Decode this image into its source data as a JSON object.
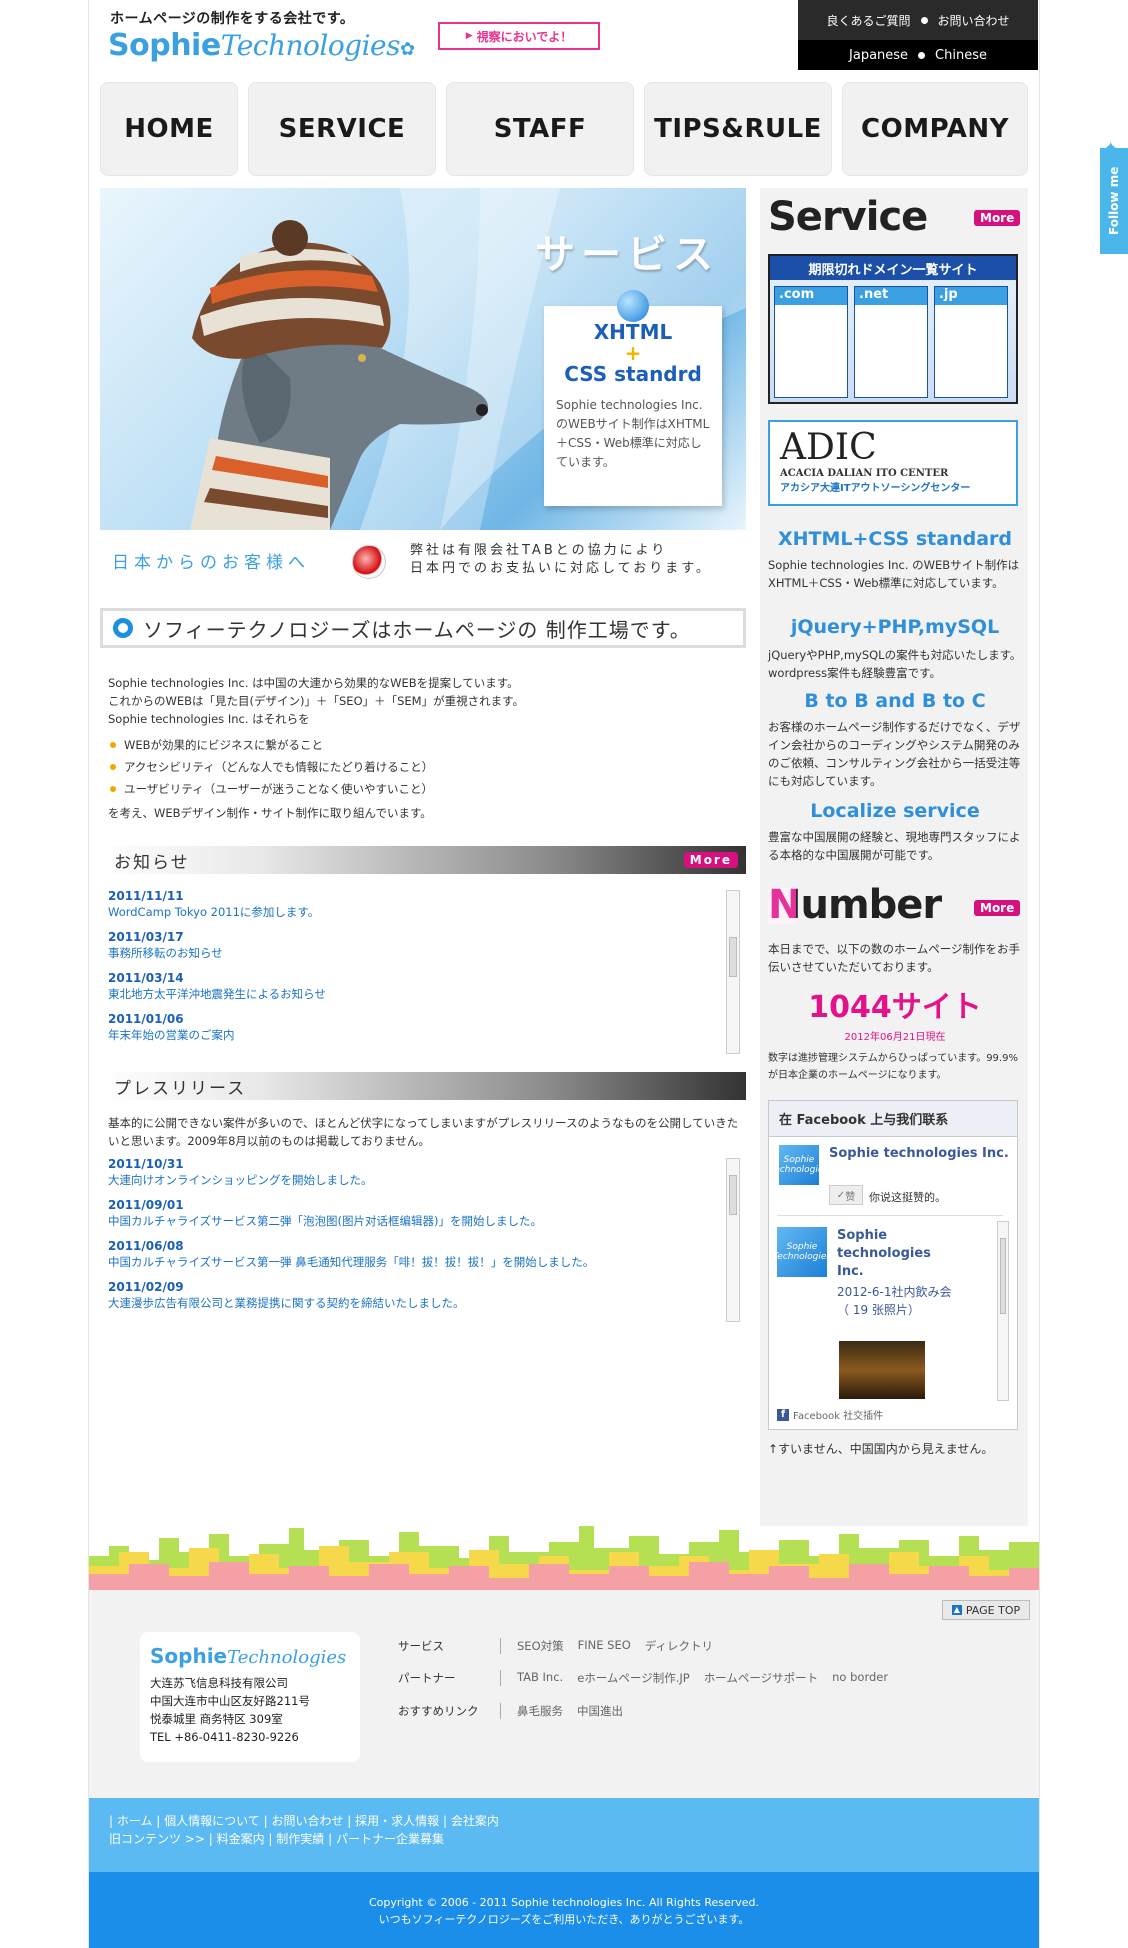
{
  "header": {
    "tagline": "ホームページの制作をする会社です。",
    "logo_main": "Sophie",
    "logo_tech": "Technologies",
    "visit_label": "視察においでよ！",
    "faq_label": "良くあるご質問",
    "contact_label": "お問い合わせ",
    "lang_ja": "Japanese",
    "lang_zh": "Chinese"
  },
  "nav": [
    "HOME",
    "SERVICE",
    "STAFF",
    "TIPS&RULE",
    "COMPANY"
  ],
  "hero": {
    "title": "サービス",
    "card_line1": "XHTML",
    "card_plus": "+",
    "card_line2": "CSS standrd",
    "card_body": "Sophie technologies Inc. のWEBサイト制作はXHTML＋CSS・Web標準に対応しています。"
  },
  "customer": {
    "title": "日本からのお客様へ",
    "line1": "弊社は有限会社TABとの協力により",
    "line2": "日本円でのお支払いに対応しております。"
  },
  "factory_heading": "ソフィーテクノロジーズはホームページの 制作工場です。",
  "intro": {
    "line1": "Sophie technologies Inc. は中国の大連から効果的なWEBを提案しています。",
    "line2": "これからのWEBは「見た目(デザイン)」＋「SEO」＋「SEM」が重視されます。",
    "line3": "Sophie technologies Inc. はそれらを",
    "bullets": [
      "WEBが効果的にビジネスに繋がること",
      "アクセシビリティ（どんな人でも情報にたどり着けること）",
      "ユーザビリティ（ユーザーが迷うことなく使いやすいこと）"
    ],
    "closing": "を考え、WEBデザイン制作・サイト制作に取り組んでいます。"
  },
  "news": {
    "heading": "お知らせ",
    "more": "More",
    "items": [
      {
        "date": "2011/11/11",
        "title": "WordCamp Tokyo 2011に参加します。"
      },
      {
        "date": "2011/03/17",
        "title": "事務所移転のお知らせ"
      },
      {
        "date": "2011/03/14",
        "title": "東北地方太平洋沖地震発生によるお知らせ"
      },
      {
        "date": "2011/01/06",
        "title": "年末年始の営業のご案内"
      }
    ]
  },
  "press": {
    "heading": "プレスリリース",
    "intro": "基本的に公開できない案件が多いので、ほとんど伏字になってしまいますがプレスリリースのようなものを公開していきたいと思います。2009年8月以前のものは掲載しておりません。",
    "items": [
      {
        "date": "2011/10/31",
        "title": "大連向けオンラインショッピングを開始しました。"
      },
      {
        "date": "2011/09/01",
        "title": "中国カルチャライズサービス第二弾「泡泡图(图片对话框编辑器)」を開始しました。"
      },
      {
        "date": "2011/06/08",
        "title": "中国カルチャライズサービス第一弾 鼻毛通知代理服务「啡！拔！拔！拔！」を開始しました。"
      },
      {
        "date": "2011/02/09",
        "title": "大連漫歩広告有限公司と業務提携に関する契約を締結いたしました。"
      }
    ]
  },
  "sidebar": {
    "service_heading": "Service",
    "more": "More",
    "domain_banner_title": "期限切れドメイン一覧サイト",
    "domain_tags": [
      ".com",
      ".net",
      ".jp"
    ],
    "adic_title": "ADIC",
    "adic_en": "ACACIA DALIAN ITO CENTER",
    "adic_ja": "アカシア大連ITアウトソーシングセンター",
    "xhtml_heading": "XHTML+CSS standard",
    "xhtml_text": "Sophie technologies Inc. のWEBサイト制作はXHTML＋CSS・Web標準に対応しています。",
    "jquery_heading": "jQuery+PHP,mySQL",
    "jquery_text": "jQueryやPHP,mySQLの案件も対応いたします。wordpress案件も経験豊富です。",
    "btob_heading": "B to B and B to C",
    "btob_text": "お客様のホームページ制作するだけでなく、デザイン会社からのコーディングやシステム開発のみのご依頼、コンサルティング会社から一括受注等にも対応しています。",
    "localize_heading": "Localize service",
    "localize_text": "豊富な中国展開の経験と、現地専門スタッフによる本格的な中国展開が可能です。",
    "number_heading": "Number",
    "number_text": "本日までで、以下の数のホームページ制作をお手伝いさせていただいております。",
    "number_value": "1044サイト",
    "number_date": "2012年06月21日現在",
    "number_note": "数字は進捗管理システムからひっぱっています。99.9%が日本企業のホームページになります。",
    "fb_heading": "在 Facebook 上与我们联系",
    "fb_page_name": "Sophie technologies Inc.",
    "fb_like": "赞",
    "fb_like_text": "你说这挺赞的。",
    "fb_post_name": "Sophie technologies Inc.",
    "fb_post_link": "2012-6-1社内飲み会 （ 19 张照片）",
    "fb_plugin": "Facebook 社交插件",
    "fb_logo_text": "Sophie Technologies",
    "fb_note": "↑すいません、中国国内から見えません。"
  },
  "footer": {
    "pagetop": "PAGE TOP",
    "company_cn": "大连苏飞信息科技有限公司",
    "addr1": "中国大连市中山区友好路211号",
    "addr2": "悦泰城里 商务特区 309室",
    "tel": "TEL +86-0411-8230-9226",
    "rows": [
      {
        "key": "サービス",
        "values": [
          "SEO対策",
          "FINE SEO",
          "ディレクトリ"
        ]
      },
      {
        "key": "パートナー",
        "values": [
          "TAB Inc.",
          "eホームページ制作.JP",
          "ホームページサポート",
          "no border"
        ]
      },
      {
        "key": "おすすめリンク",
        "values": [
          "鼻毛服务",
          "中国進出"
        ]
      }
    ],
    "links_line1": "| ホーム | 個人情報について | お問い合わせ | 採用・求人情報 | 会社案内",
    "links_line2": "旧コンテンツ >> | 料金案内 | 制作実績 | パートナー企業募集",
    "copyright": "Copyright © 2006 - 2011 Sophie technologies Inc. All Rights Reserved.",
    "thanks": "いつもソフィーテクノロジーズをご利用いただき、ありがとうございます。"
  },
  "follow_me": "Follow me"
}
